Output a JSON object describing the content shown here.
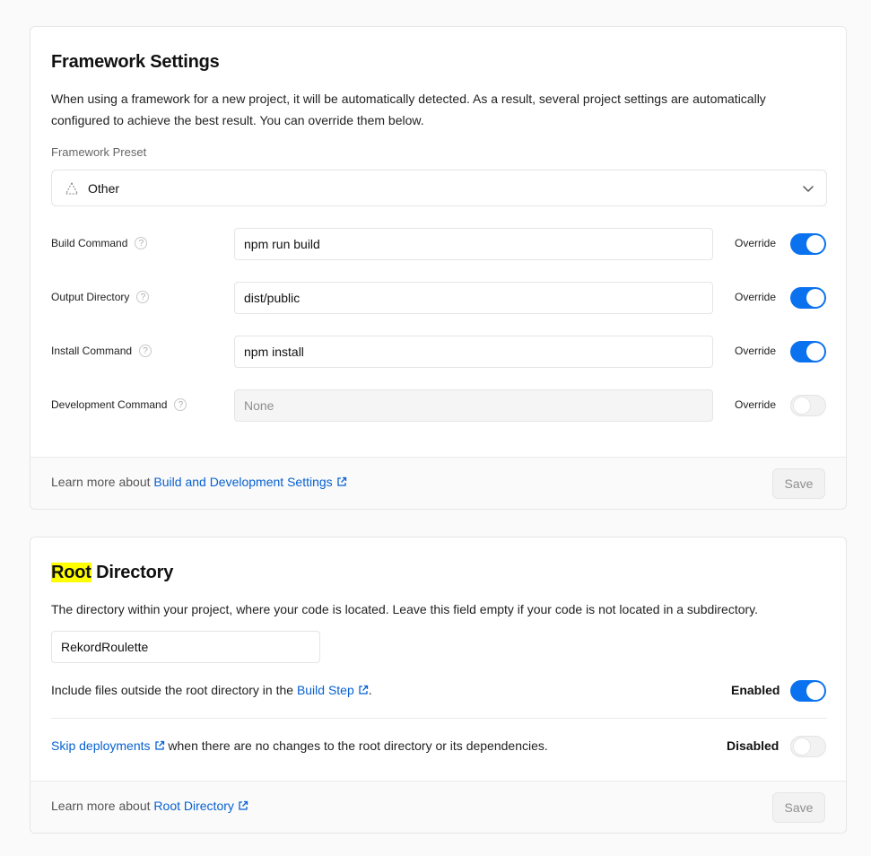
{
  "framework": {
    "title": "Framework Settings",
    "description": "When using a framework for a new project, it will be automatically detected. As a result, several project settings are automatically configured to achieve the best result. You can override them below.",
    "preset_label": "Framework Preset",
    "preset_value": "Other",
    "rows": [
      {
        "label": "Build Command",
        "value": "npm run build",
        "override_label": "Override",
        "override": true
      },
      {
        "label": "Output Directory",
        "value": "dist/public",
        "override_label": "Override",
        "override": true
      },
      {
        "label": "Install Command",
        "value": "npm install",
        "override_label": "Override",
        "override": true
      },
      {
        "label": "Development Command",
        "placeholder": "None",
        "override_label": "Override",
        "override": false
      }
    ],
    "footer_prefix": "Learn more about",
    "footer_link": "Build and Development Settings",
    "save_label": "Save"
  },
  "root": {
    "title_highlight": "Root",
    "title_rest": "Directory",
    "description": "The directory within your project, where your code is located. Leave this field empty if your code is not located in a subdirectory.",
    "input_value": "RekordRoulette",
    "include_text": "Include files outside the root directory in the",
    "include_link": "Build Step",
    "include_suffix": ".",
    "include_state": "Enabled",
    "include_on": true,
    "skip_link": "Skip deployments",
    "skip_text": "when there are no changes to the root directory or its dependencies.",
    "skip_state": "Disabled",
    "skip_on": false,
    "footer_prefix": "Learn more about",
    "footer_link": "Root Directory",
    "save_label": "Save"
  },
  "colors": {
    "accent": "#0a72ef",
    "link": "#0761d1",
    "highlight": "#ffff00"
  },
  "icons": {
    "preset": "triangle-icon",
    "dropdown": "chevron-down-icon",
    "help": "help-circle-icon",
    "external": "external-link-icon"
  }
}
